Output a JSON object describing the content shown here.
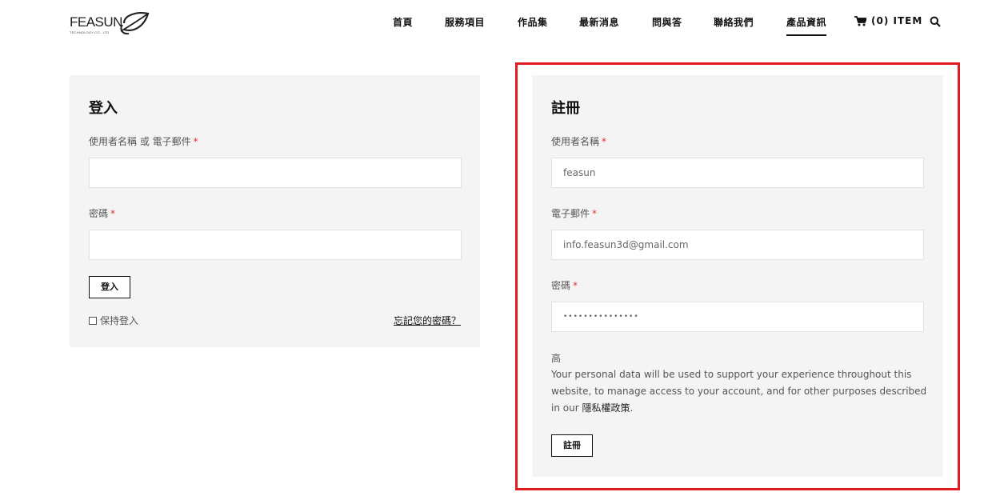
{
  "header": {
    "logo": {
      "word": "FEASUN",
      "tagline": "TECHNOLOGY CO., LTD"
    },
    "nav": [
      {
        "label": "首頁"
      },
      {
        "label": "服務項目"
      },
      {
        "label": "作品集"
      },
      {
        "label": "最新消息"
      },
      {
        "label": "問與答"
      },
      {
        "label": "聯絡我們"
      },
      {
        "label": "產品資訊",
        "active": true
      }
    ],
    "cart": {
      "label": "(0) ITEM",
      "icon": "cart-icon"
    },
    "search": {
      "icon": "search-icon"
    }
  },
  "login": {
    "title": "登入",
    "username_label": "使用者名稱 或 電子郵件",
    "username_value": "",
    "password_label": "密碼",
    "password_value": "",
    "required_mark": "*",
    "submit_label": "登入",
    "remember_label": "保持登入",
    "forgot_label": "忘記您的密碼？"
  },
  "register": {
    "title": "註冊",
    "username_label": "使用者名稱",
    "username_value": "feasun",
    "email_label": "電子郵件",
    "email_value": "info.feasun3d@gmail.com",
    "password_label": "密碼",
    "password_value": "•••••••••••••••",
    "required_mark": "*",
    "strength": "高",
    "privacy_text": "Your personal data will be used to support your experience throughout this website, to manage access to your account, and for other purposes described in our ",
    "privacy_link": "隱私權政策",
    "privacy_end": ".",
    "submit_label": "註冊"
  },
  "colors": {
    "highlight": "#e11b22",
    "panel_bg": "#f4f4f4",
    "required": "#d33"
  }
}
